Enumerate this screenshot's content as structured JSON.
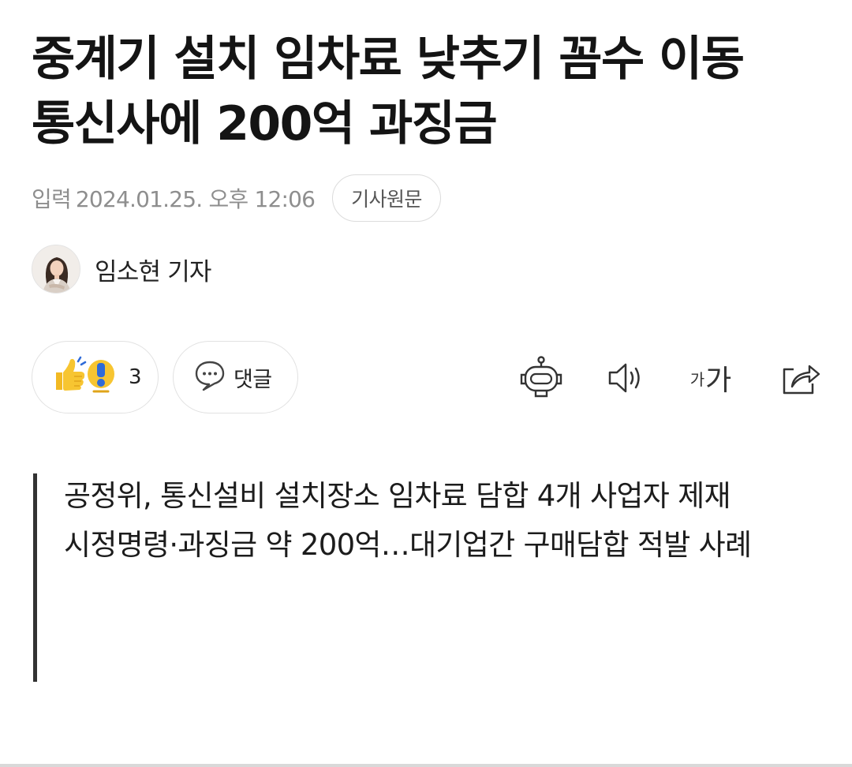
{
  "article": {
    "title_line1": "중계기 설치 임차료 낮추기 꼼수 이동",
    "title_line2": "통신사에 200억 과징금",
    "date_label": "입력",
    "date_value": "2024.01.25. 오후 12:06",
    "origin_button": "기사원문",
    "author_name": "임소현 기자"
  },
  "actions": {
    "reaction_count": "3",
    "comment_label": "댓글",
    "font_small": "가",
    "font_big": "가"
  },
  "icons": {
    "reaction": "thumbs-up-surprise-emoji",
    "comment": "speech-bubble-icon",
    "summary_bot": "robot-icon",
    "tts": "speaker-icon",
    "font_size": "font-size-icon",
    "share": "share-icon"
  },
  "summary": {
    "line1": "공정위, 통신설비 설치장소 임차료 담합 4개 사업자 제재",
    "line2": "시정명령·과징금 약 200억…대기업간 구매담합 적발 사례"
  },
  "colors": {
    "text": "#141414",
    "meta": "#8e8e8e",
    "border": "#e1e1e1",
    "quote_bar": "#333333",
    "emoji_yellow": "#f7c531",
    "emoji_blue": "#2f6bd8"
  }
}
